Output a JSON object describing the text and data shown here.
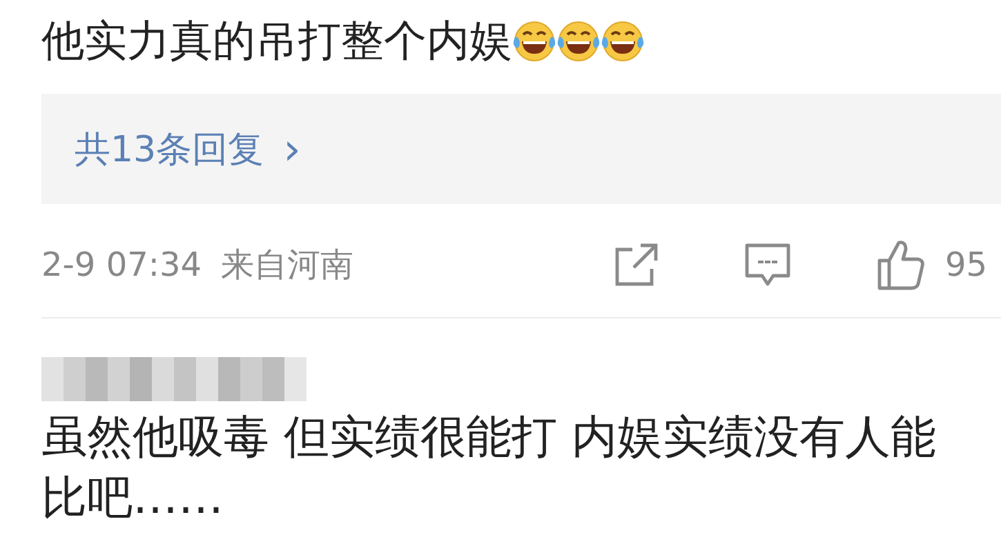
{
  "comments": [
    {
      "text": "他实力真的吊打整个内娱",
      "emojis": [
        {
          "kind": "laughing"
        },
        {
          "kind": "laughing"
        },
        {
          "kind": "laughing"
        }
      ],
      "replies": {
        "label": "共13条回复",
        "chevron": "›"
      },
      "meta": {
        "time": "2-9 07:34",
        "location": "来自河南",
        "likes": "95"
      }
    },
    {
      "text": "虽然他吸毒 但实绩很能打 内娱实绩没有人能比吧……",
      "author_hidden": true
    }
  ]
}
